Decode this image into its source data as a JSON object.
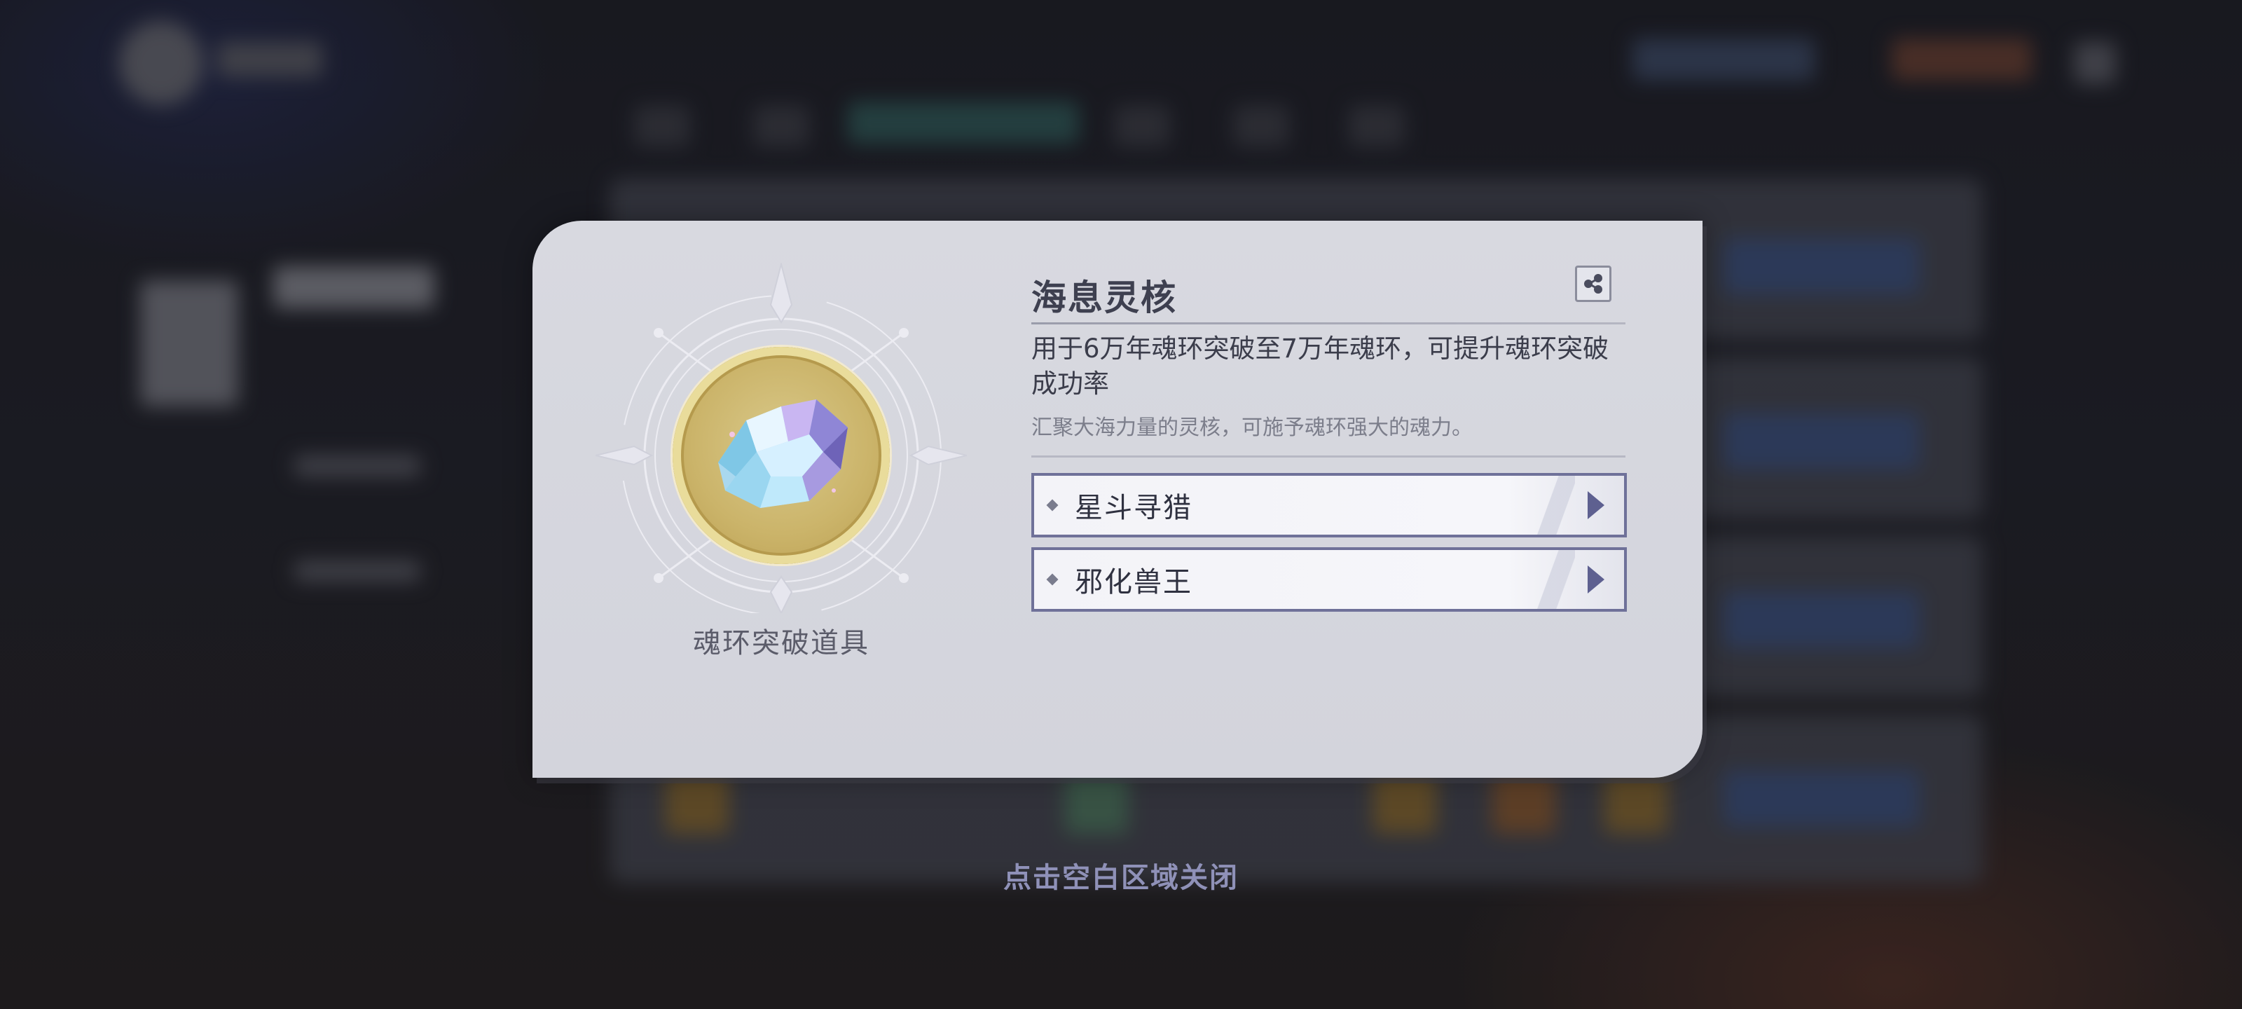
{
  "item": {
    "name": "海息灵核",
    "category": "魂环突破道具",
    "usage": "用于6万年魂环突破至7万年魂环，可提升魂环突破成功率",
    "flavor": "汇聚大海力量的灵核，可施予魂环强大的魂力。",
    "icon": "crystal-icon",
    "medallion_color": "#cbb46a"
  },
  "sources": [
    {
      "label": "星斗寻猎"
    },
    {
      "label": "邪化兽王"
    }
  ],
  "share_icon": "share-icon",
  "close_hint": "点击空白区域关闭",
  "colors": {
    "panel_bg": "#d6d7de",
    "accent": "#6f7199",
    "hint": "#8f91b8"
  }
}
